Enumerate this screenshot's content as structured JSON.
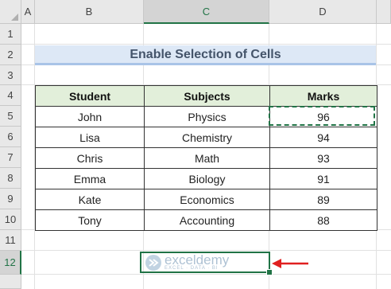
{
  "columns": [
    "A",
    "B",
    "C",
    "D"
  ],
  "rows": [
    "1",
    "2",
    "3",
    "4",
    "5",
    "6",
    "7",
    "8",
    "9",
    "10",
    "11",
    "12"
  ],
  "title": "Enable Selection of Cells",
  "table": {
    "headers": [
      "Student",
      "Subjects",
      "Marks"
    ],
    "rows": [
      [
        "John",
        "Physics",
        "96"
      ],
      [
        "Lisa",
        "Chemistry",
        "94"
      ],
      [
        "Chris",
        "Math",
        "93"
      ],
      [
        "Emma",
        "Biology",
        "91"
      ],
      [
        "Kate",
        "Economics",
        "89"
      ],
      [
        "Tony",
        "Accounting",
        "88"
      ]
    ]
  },
  "watermark": {
    "name": "exceldemy",
    "tagline": "EXCEL · DATA · BI"
  },
  "colors": {
    "accent": "#217346",
    "arrow": "#e02020",
    "header_fill": "#e2efda",
    "title_fill": "#dde8f6"
  }
}
